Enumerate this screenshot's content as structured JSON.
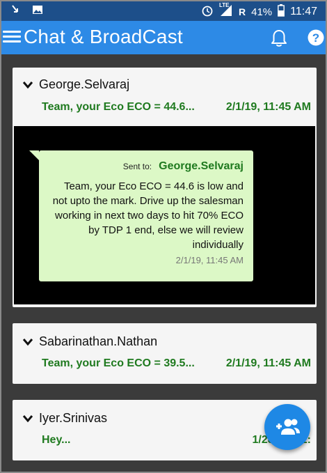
{
  "status_bar": {
    "network_label": "LTE",
    "roaming_label": "R",
    "battery": "41%",
    "time": "11:47"
  },
  "app_bar": {
    "title": "Chat & BroadCast"
  },
  "conversations": [
    {
      "name": "George.Selvaraj",
      "preview": "Team, your Eco ECO = 44.6...",
      "date": "2/1/19, 11:45 AM",
      "expanded": true,
      "message": {
        "sent_to_label": "Sent to:",
        "recipient": "George.Selvaraj",
        "text": "Team, your Eco ECO = 44.6 is low and not upto the mark. Drive up the salesman working in next two days to hit 70% ECO by TDP 1 end, else we will review individually",
        "timestamp": "2/1/19, 11:45 AM"
      }
    },
    {
      "name": "Sabarinathan.Nathan",
      "preview": "Team, your Eco ECO = 39.5...",
      "date": "2/1/19, 11:45 AM",
      "expanded": false
    },
    {
      "name": "Iyer.Srinivas",
      "preview": "Hey...",
      "date": "1/28/19, 11:",
      "expanded": false
    }
  ],
  "colors": {
    "status_bar": "#1d4f8a",
    "app_bar": "#2d8ae6",
    "accent_green": "#1f7a1f",
    "bubble": "#dcf8c6",
    "fab": "#1e88e5"
  },
  "icons": [
    "menu-icon",
    "notification-bell-icon",
    "help-icon",
    "chevron-down-icon",
    "add-group-icon"
  ]
}
